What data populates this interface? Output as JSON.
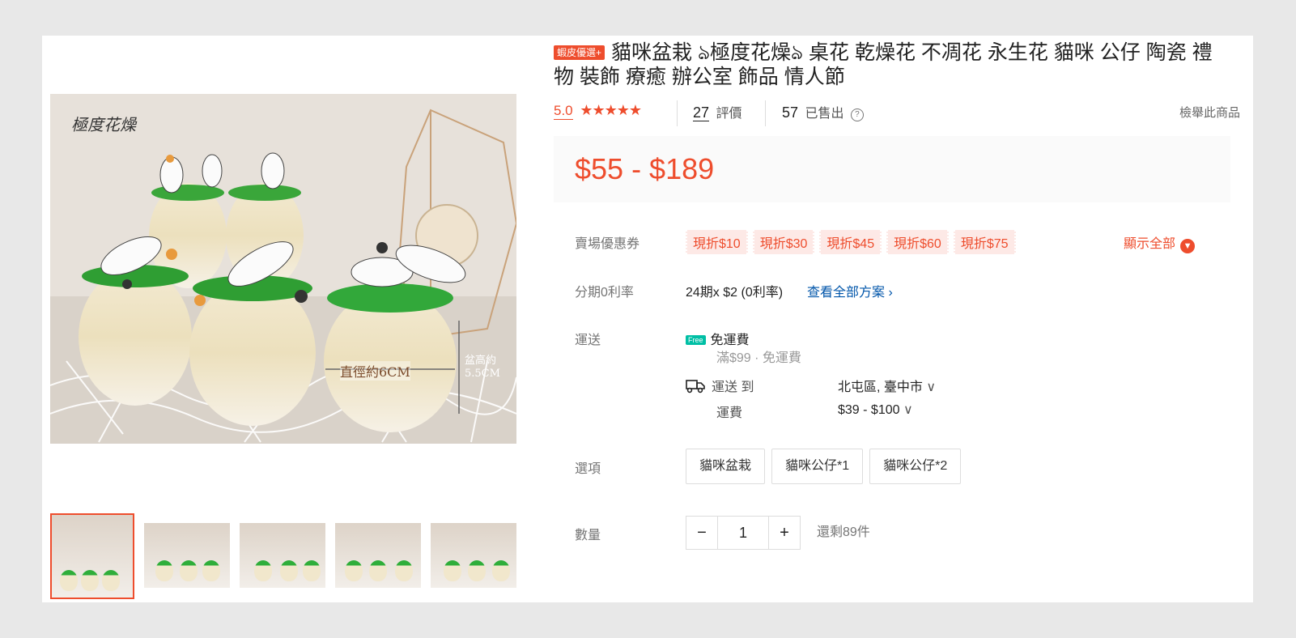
{
  "product": {
    "badge": "蝦皮優選+",
    "title": "貓咪盆栽 ঌ極度花燥ঌ 桌花 乾燥花 不凋花 永生花 貓咪 公仔 陶瓷 禮物 裝飾 療癒 辦公室 飾品 情人節",
    "rating": "5.0",
    "stars": "★★★★★",
    "review_count": "27",
    "review_label": "評價",
    "sold_count": "57",
    "sold_label": "已售出",
    "report_label": "檢舉此商品",
    "price": "$55 - $189"
  },
  "image": {
    "watermark": "極度花燥",
    "diameter_label": "直徑約6CM",
    "height_label": "盆高約5.5CM"
  },
  "vouchers": {
    "label": "賣場優惠券",
    "items": [
      "現折$10",
      "現折$30",
      "現折$45",
      "現折$60",
      "現折$75"
    ],
    "show_all": "顯示全部"
  },
  "installment": {
    "label": "分期0利率",
    "text": "24期x $2 (0利率)",
    "link": "查看全部方案"
  },
  "shipping": {
    "label": "運送",
    "free_tag": "Free",
    "free_title": "免運費",
    "free_note": "滿$99 · 免運費",
    "to_label": "運送 到",
    "location": "北屯區, 臺中市",
    "fee_label": "運費",
    "fee_value": "$39 - $100"
  },
  "options": {
    "label": "選項",
    "items": [
      "貓咪盆栽",
      "貓咪公仔*1",
      "貓咪公仔*2"
    ]
  },
  "quantity": {
    "label": "數量",
    "minus": "−",
    "value": "1",
    "plus": "+",
    "stock": "還剩89件"
  },
  "colors": {
    "accent": "#ee4d2d",
    "link": "#0055aa",
    "free": "#00bfa5"
  }
}
